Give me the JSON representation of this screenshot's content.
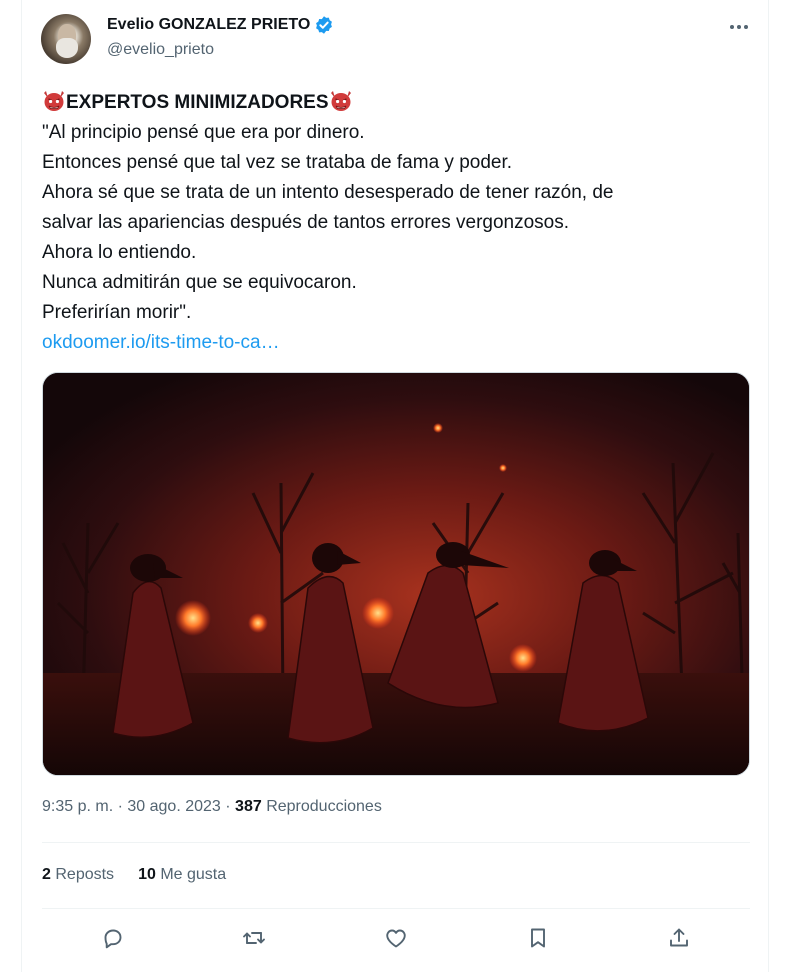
{
  "author": {
    "name": "Evelio GONZALEZ PRIETO",
    "handle": "@evelio_prieto"
  },
  "tweet": {
    "headline": "EXPERTOS MINIMIZADORES",
    "headline_emoji": "goblin-mask-emoji",
    "lines": [
      "\"Al principio pensé que era por dinero.",
      "Entonces pensé que tal vez se trataba de fama y poder.",
      "Ahora sé que se trata de un intento desesperado de tener razón, de",
      "salvar las apariencias después de tantos errores vergonzosos.",
      "Ahora lo entiendo.",
      "Nunca admitirán que se equivocaron.",
      "Preferirían morir\"."
    ],
    "link": "okdoomer.io/its-time-to-ca…"
  },
  "meta": {
    "time": "9:35 p. m.",
    "separator": "·",
    "date": "30 ago. 2023",
    "views_count": "387",
    "views_label": "Reproducciones"
  },
  "stats": {
    "reposts_count": "2",
    "reposts_label": "Reposts",
    "likes_count": "10",
    "likes_label": "Me gusta"
  },
  "colors": {
    "link": "#1d9bf0",
    "verified": "#1d9bf0",
    "muted_text": "#536471"
  },
  "icons": [
    "verified-badge-icon",
    "more-icon",
    "reply-icon",
    "repost-icon",
    "like-icon",
    "bookmark-icon",
    "share-icon"
  ]
}
